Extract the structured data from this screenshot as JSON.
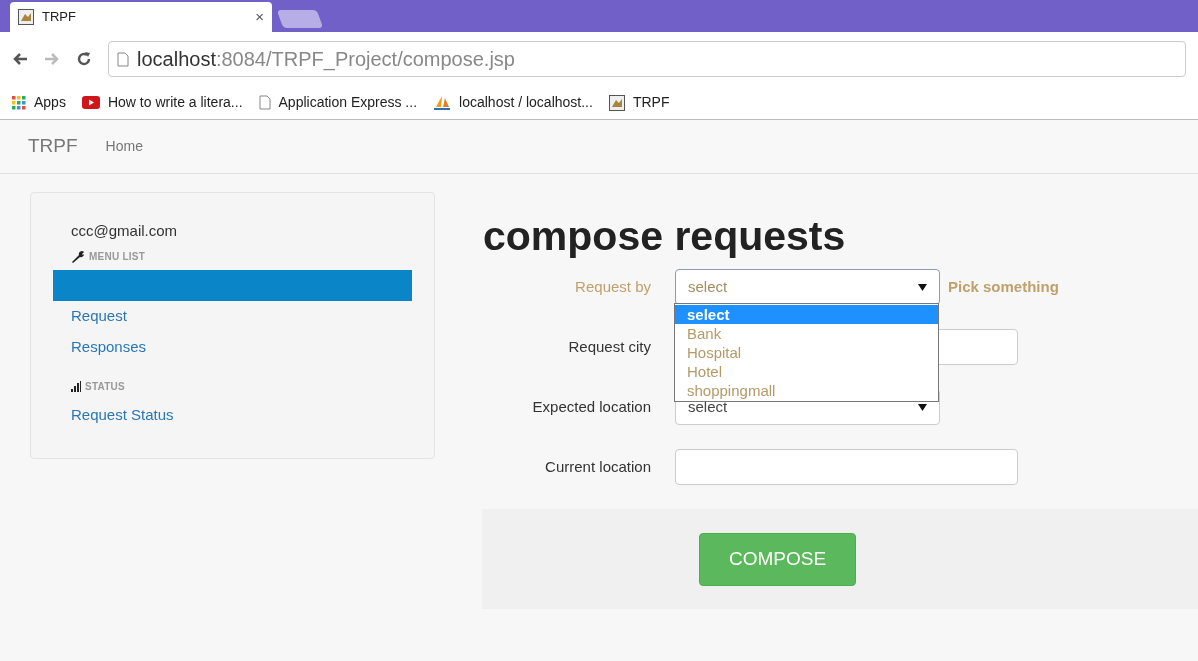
{
  "browser": {
    "tab": {
      "title": "TRPF",
      "close": "×"
    },
    "address": {
      "host": "localhost",
      "path": ":8084/TRPF_Project/compose.jsp"
    },
    "bookmarks": [
      {
        "kind": "apps",
        "label": "Apps"
      },
      {
        "kind": "video",
        "label": "How to write a litera..."
      },
      {
        "kind": "page",
        "label": "Application Express ..."
      },
      {
        "kind": "pma",
        "label": "localhost / localhost..."
      },
      {
        "kind": "site",
        "label": "TRPF"
      }
    ]
  },
  "navbar": {
    "brand": "TRPF",
    "links": [
      "Home"
    ]
  },
  "sidebar": {
    "user": "ccc@gmail.com",
    "sections": [
      {
        "kind": "menu",
        "heading": "MENU LIST",
        "items": [
          {
            "selected": true
          },
          {
            "label": "Request",
            "selected": false
          },
          {
            "label": "Responses",
            "selected": false
          }
        ]
      },
      {
        "kind": "status",
        "heading": "STATUS",
        "items": [
          {
            "label": "Request Status",
            "selected": false
          }
        ]
      }
    ]
  },
  "form": {
    "title": "compose requests",
    "fields": [
      {
        "label": "Request by",
        "kind": "select",
        "value": "select",
        "warning": true,
        "help": "Pick something",
        "open": true,
        "options": [
          {
            "label": "select",
            "selected": true
          },
          {
            "label": "Bank",
            "selected": false
          },
          {
            "label": "Hospital",
            "selected": false
          },
          {
            "label": "Hotel",
            "selected": false
          },
          {
            "label": "shoppingmall",
            "selected": false
          }
        ]
      },
      {
        "label": "Request city",
        "kind": "text",
        "warning": false
      },
      {
        "label": "Expected location",
        "kind": "select",
        "value": "select",
        "warning": false,
        "open": false
      },
      {
        "label": "Current location",
        "kind": "text",
        "warning": false
      }
    ],
    "submit": "COMPOSE"
  }
}
